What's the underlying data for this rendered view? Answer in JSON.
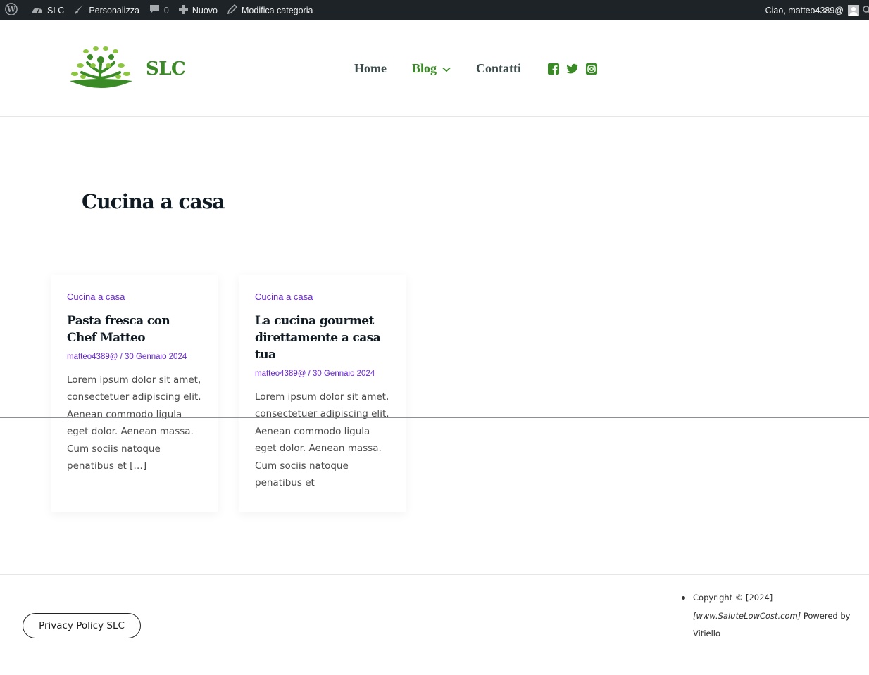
{
  "admin_bar": {
    "site": "SLC",
    "customize": "Personalizza",
    "comments_count": "0",
    "new": "Nuovo",
    "edit_category": "Modifica categoria",
    "greeting": "Ciao, matteo4389@"
  },
  "header": {
    "brand_name": "SLC",
    "nav": [
      {
        "label": "Home"
      },
      {
        "label": "Blog"
      },
      {
        "label": "Contatti"
      }
    ],
    "social_icons": [
      "facebook-icon",
      "twitter-icon",
      "instagram-icon"
    ]
  },
  "main": {
    "title": "Cucina a casa",
    "posts": [
      {
        "category": "Cucina a casa",
        "title": "Pasta fresca con Chef Matteo",
        "meta": "matteo4389@ / 30 Gennaio 2024",
        "excerpt": "Lorem ipsum dolor sit amet, consectetuer adipiscing elit. Aenean commodo ligula eget dolor. Aenean massa. Cum sociis natoque penatibus et […]"
      },
      {
        "category": "Cucina a casa",
        "title": "La cucina gourmet direttamente a casa tua",
        "meta": "matteo4389@ / 30 Gennaio 2024",
        "excerpt": "Lorem ipsum dolor sit amet, consectetuer adipiscing elit. Aenean commodo ligula eget dolor. Aenean massa. Cum sociis natoque penatibus et"
      }
    ]
  },
  "footer": {
    "privacy_label": "Privacy Policy SLC",
    "copyright": "Copyright © [2024]",
    "site_ref": "[www.SaluteLowCost.com]",
    "powered": "Powered by Vitiello"
  },
  "colors": {
    "accent_green": "#3a8a26",
    "category_purple": "#6a27d6",
    "admin_bar_bg": "#1d2327"
  }
}
